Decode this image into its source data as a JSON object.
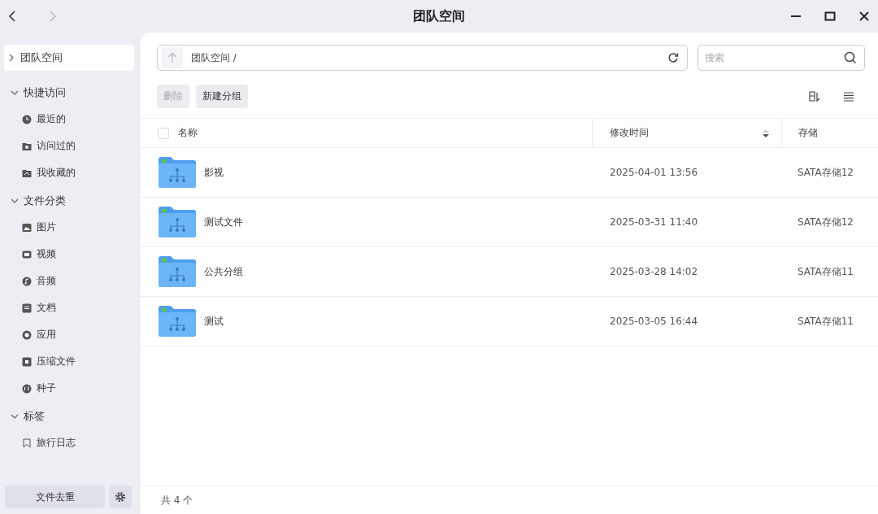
{
  "window": {
    "title": "团队空间"
  },
  "sidebar": {
    "top_item": {
      "label": "团队空间",
      "selected": true,
      "expanded": false
    },
    "sections": [
      {
        "title": "快捷访问",
        "expanded": true,
        "items": [
          {
            "label": "最近的",
            "kind": "clock"
          },
          {
            "label": "访问过的",
            "kind": "visited"
          },
          {
            "label": "我收藏的",
            "kind": "favorite"
          }
        ]
      },
      {
        "title": "文件分类",
        "expanded": true,
        "items": [
          {
            "label": "图片",
            "kind": "image"
          },
          {
            "label": "视频",
            "kind": "video"
          },
          {
            "label": "音频",
            "kind": "audio"
          },
          {
            "label": "文档",
            "kind": "doc"
          },
          {
            "label": "应用",
            "kind": "app"
          },
          {
            "label": "压缩文件",
            "kind": "archive"
          },
          {
            "label": "种子",
            "kind": "torrent"
          }
        ]
      },
      {
        "title": "标签",
        "expanded": true,
        "items": [
          {
            "label": "旅行日志",
            "kind": "tag"
          }
        ]
      }
    ],
    "footer_button": "文件去重"
  },
  "address_bar": {
    "path": "团队空间 /"
  },
  "search": {
    "placeholder": "搜索"
  },
  "actions": [
    {
      "label": "删除",
      "disabled": true
    },
    {
      "label": "新建分组",
      "disabled": false
    }
  ],
  "table": {
    "select_all_checked": false,
    "columns": [
      {
        "label": "名称",
        "sortable": false
      },
      {
        "label": "修改时间",
        "sortable": true
      },
      {
        "label": "存储",
        "sortable": false
      }
    ],
    "rows": [
      {
        "name": "影视",
        "modified": "2025-04-01 13:56",
        "storage": "SATA存储12"
      },
      {
        "name": "测试文件",
        "modified": "2025-03-31 11:40",
        "storage": "SATA存储12"
      },
      {
        "name": "公共分组",
        "modified": "2025-03-28 14:02",
        "storage": "SATA存储11"
      },
      {
        "name": "测试",
        "modified": "2025-03-05 16:44",
        "storage": "SATA存储11"
      }
    ]
  },
  "status_bar": "共 4 个"
}
